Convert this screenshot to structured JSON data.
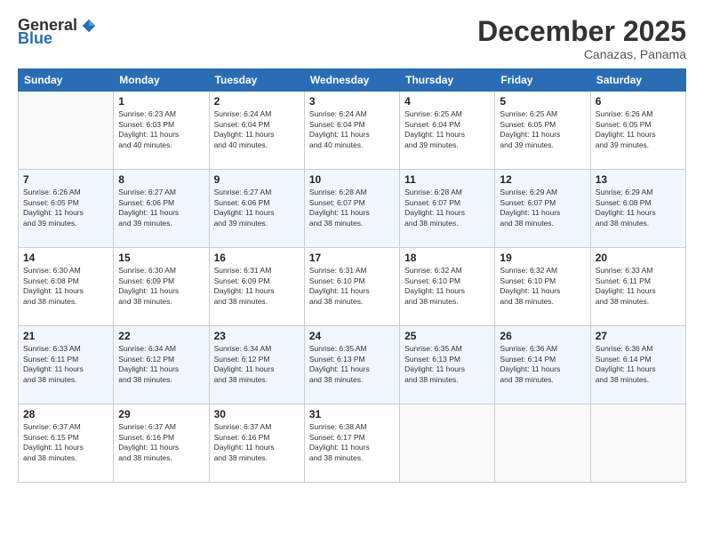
{
  "header": {
    "logo_general": "General",
    "logo_blue": "Blue",
    "month": "December 2025",
    "location": "Canazas, Panama"
  },
  "days_of_week": [
    "Sunday",
    "Monday",
    "Tuesday",
    "Wednesday",
    "Thursday",
    "Friday",
    "Saturday"
  ],
  "weeks": [
    [
      {
        "num": "",
        "info": ""
      },
      {
        "num": "1",
        "info": "Sunrise: 6:23 AM\nSunset: 6:03 PM\nDaylight: 11 hours\nand 40 minutes."
      },
      {
        "num": "2",
        "info": "Sunrise: 6:24 AM\nSunset: 6:04 PM\nDaylight: 11 hours\nand 40 minutes."
      },
      {
        "num": "3",
        "info": "Sunrise: 6:24 AM\nSunset: 6:04 PM\nDaylight: 11 hours\nand 40 minutes."
      },
      {
        "num": "4",
        "info": "Sunrise: 6:25 AM\nSunset: 6:04 PM\nDaylight: 11 hours\nand 39 minutes."
      },
      {
        "num": "5",
        "info": "Sunrise: 6:25 AM\nSunset: 6:05 PM\nDaylight: 11 hours\nand 39 minutes."
      },
      {
        "num": "6",
        "info": "Sunrise: 6:26 AM\nSunset: 6:05 PM\nDaylight: 11 hours\nand 39 minutes."
      }
    ],
    [
      {
        "num": "7",
        "info": "Sunrise: 6:26 AM\nSunset: 6:05 PM\nDaylight: 11 hours\nand 39 minutes."
      },
      {
        "num": "8",
        "info": "Sunrise: 6:27 AM\nSunset: 6:06 PM\nDaylight: 11 hours\nand 39 minutes."
      },
      {
        "num": "9",
        "info": "Sunrise: 6:27 AM\nSunset: 6:06 PM\nDaylight: 11 hours\nand 39 minutes."
      },
      {
        "num": "10",
        "info": "Sunrise: 6:28 AM\nSunset: 6:07 PM\nDaylight: 11 hours\nand 38 minutes."
      },
      {
        "num": "11",
        "info": "Sunrise: 6:28 AM\nSunset: 6:07 PM\nDaylight: 11 hours\nand 38 minutes."
      },
      {
        "num": "12",
        "info": "Sunrise: 6:29 AM\nSunset: 6:07 PM\nDaylight: 11 hours\nand 38 minutes."
      },
      {
        "num": "13",
        "info": "Sunrise: 6:29 AM\nSunset: 6:08 PM\nDaylight: 11 hours\nand 38 minutes."
      }
    ],
    [
      {
        "num": "14",
        "info": "Sunrise: 6:30 AM\nSunset: 6:08 PM\nDaylight: 11 hours\nand 38 minutes."
      },
      {
        "num": "15",
        "info": "Sunrise: 6:30 AM\nSunset: 6:09 PM\nDaylight: 11 hours\nand 38 minutes."
      },
      {
        "num": "16",
        "info": "Sunrise: 6:31 AM\nSunset: 6:09 PM\nDaylight: 11 hours\nand 38 minutes."
      },
      {
        "num": "17",
        "info": "Sunrise: 6:31 AM\nSunset: 6:10 PM\nDaylight: 11 hours\nand 38 minutes."
      },
      {
        "num": "18",
        "info": "Sunrise: 6:32 AM\nSunset: 6:10 PM\nDaylight: 11 hours\nand 38 minutes."
      },
      {
        "num": "19",
        "info": "Sunrise: 6:32 AM\nSunset: 6:10 PM\nDaylight: 11 hours\nand 38 minutes."
      },
      {
        "num": "20",
        "info": "Sunrise: 6:33 AM\nSunset: 6:11 PM\nDaylight: 11 hours\nand 38 minutes."
      }
    ],
    [
      {
        "num": "21",
        "info": "Sunrise: 6:33 AM\nSunset: 6:11 PM\nDaylight: 11 hours\nand 38 minutes."
      },
      {
        "num": "22",
        "info": "Sunrise: 6:34 AM\nSunset: 6:12 PM\nDaylight: 11 hours\nand 38 minutes."
      },
      {
        "num": "23",
        "info": "Sunrise: 6:34 AM\nSunset: 6:12 PM\nDaylight: 11 hours\nand 38 minutes."
      },
      {
        "num": "24",
        "info": "Sunrise: 6:35 AM\nSunset: 6:13 PM\nDaylight: 11 hours\nand 38 minutes."
      },
      {
        "num": "25",
        "info": "Sunrise: 6:35 AM\nSunset: 6:13 PM\nDaylight: 11 hours\nand 38 minutes."
      },
      {
        "num": "26",
        "info": "Sunrise: 6:36 AM\nSunset: 6:14 PM\nDaylight: 11 hours\nand 38 minutes."
      },
      {
        "num": "27",
        "info": "Sunrise: 6:36 AM\nSunset: 6:14 PM\nDaylight: 11 hours\nand 38 minutes."
      }
    ],
    [
      {
        "num": "28",
        "info": "Sunrise: 6:37 AM\nSunset: 6:15 PM\nDaylight: 11 hours\nand 38 minutes."
      },
      {
        "num": "29",
        "info": "Sunrise: 6:37 AM\nSunset: 6:16 PM\nDaylight: 11 hours\nand 38 minutes."
      },
      {
        "num": "30",
        "info": "Sunrise: 6:37 AM\nSunset: 6:16 PM\nDaylight: 11 hours\nand 38 minutes."
      },
      {
        "num": "31",
        "info": "Sunrise: 6:38 AM\nSunset: 6:17 PM\nDaylight: 11 hours\nand 38 minutes."
      },
      {
        "num": "",
        "info": ""
      },
      {
        "num": "",
        "info": ""
      },
      {
        "num": "",
        "info": ""
      }
    ]
  ]
}
